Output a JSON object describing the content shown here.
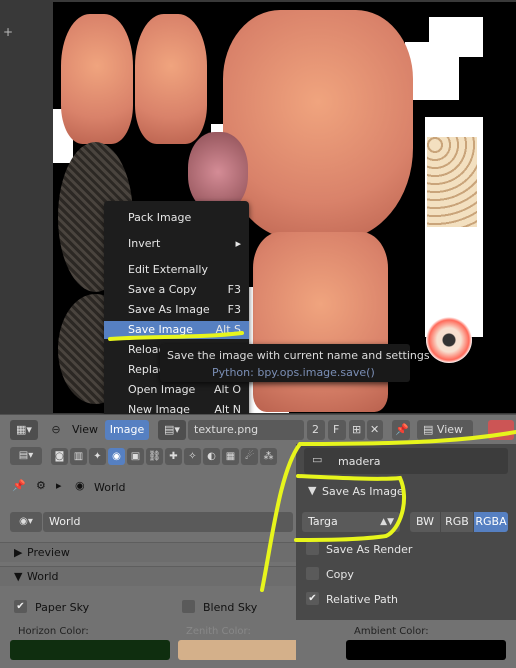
{
  "image_menu": {
    "items": [
      {
        "label": "Pack Image",
        "shortcut": ""
      },
      {
        "label": "Invert",
        "shortcut": ""
      },
      {
        "label": "Edit Externally",
        "shortcut": ""
      },
      {
        "label": "Save a Copy",
        "shortcut": "F3"
      },
      {
        "label": "Save As Image",
        "shortcut": "F3"
      },
      {
        "label": "Save Image",
        "shortcut": "Alt S"
      },
      {
        "label": "Reload",
        "shortcut": ""
      },
      {
        "label": "Replace Image",
        "shortcut": ""
      },
      {
        "label": "Open Image",
        "shortcut": "Alt O"
      },
      {
        "label": "New Image",
        "shortcut": "Alt N"
      }
    ]
  },
  "tooltip": {
    "description": "Save the image with current name and settings",
    "python": "Python: bpy.ops.image.save()"
  },
  "header": {
    "view_label": "View",
    "image_label": "Image",
    "image_name": "texture.png",
    "users": "2",
    "fake_user": "F",
    "view2_label": "View"
  },
  "properties": {
    "breadcrumb_world": "World",
    "world_name": "World",
    "preview_label": "Preview",
    "world_panel_label": "World",
    "paper_sky": "Paper Sky",
    "blend_sky": "Blend Sky",
    "horizon_color_label": "Horizon Color:",
    "zenith_color_label": "Zenith Color:",
    "ambient_color_label": "Ambient Color:"
  },
  "file_browser": {
    "directory": "madera",
    "panel_title": "Save As Image",
    "format": "Targa",
    "color_modes": [
      "BW",
      "RGB",
      "RGBA"
    ],
    "options": [
      {
        "label": "Save As Render",
        "checked": false
      },
      {
        "label": "Copy",
        "checked": false
      },
      {
        "label": "Relative Path",
        "checked": true
      }
    ]
  },
  "colors": {
    "accent": "#5680c2",
    "horizon_color": "#0f2e0f",
    "zenith_color": "#d4b08a",
    "ambient_color": "#000000",
    "annotation": "#e7f51c"
  }
}
